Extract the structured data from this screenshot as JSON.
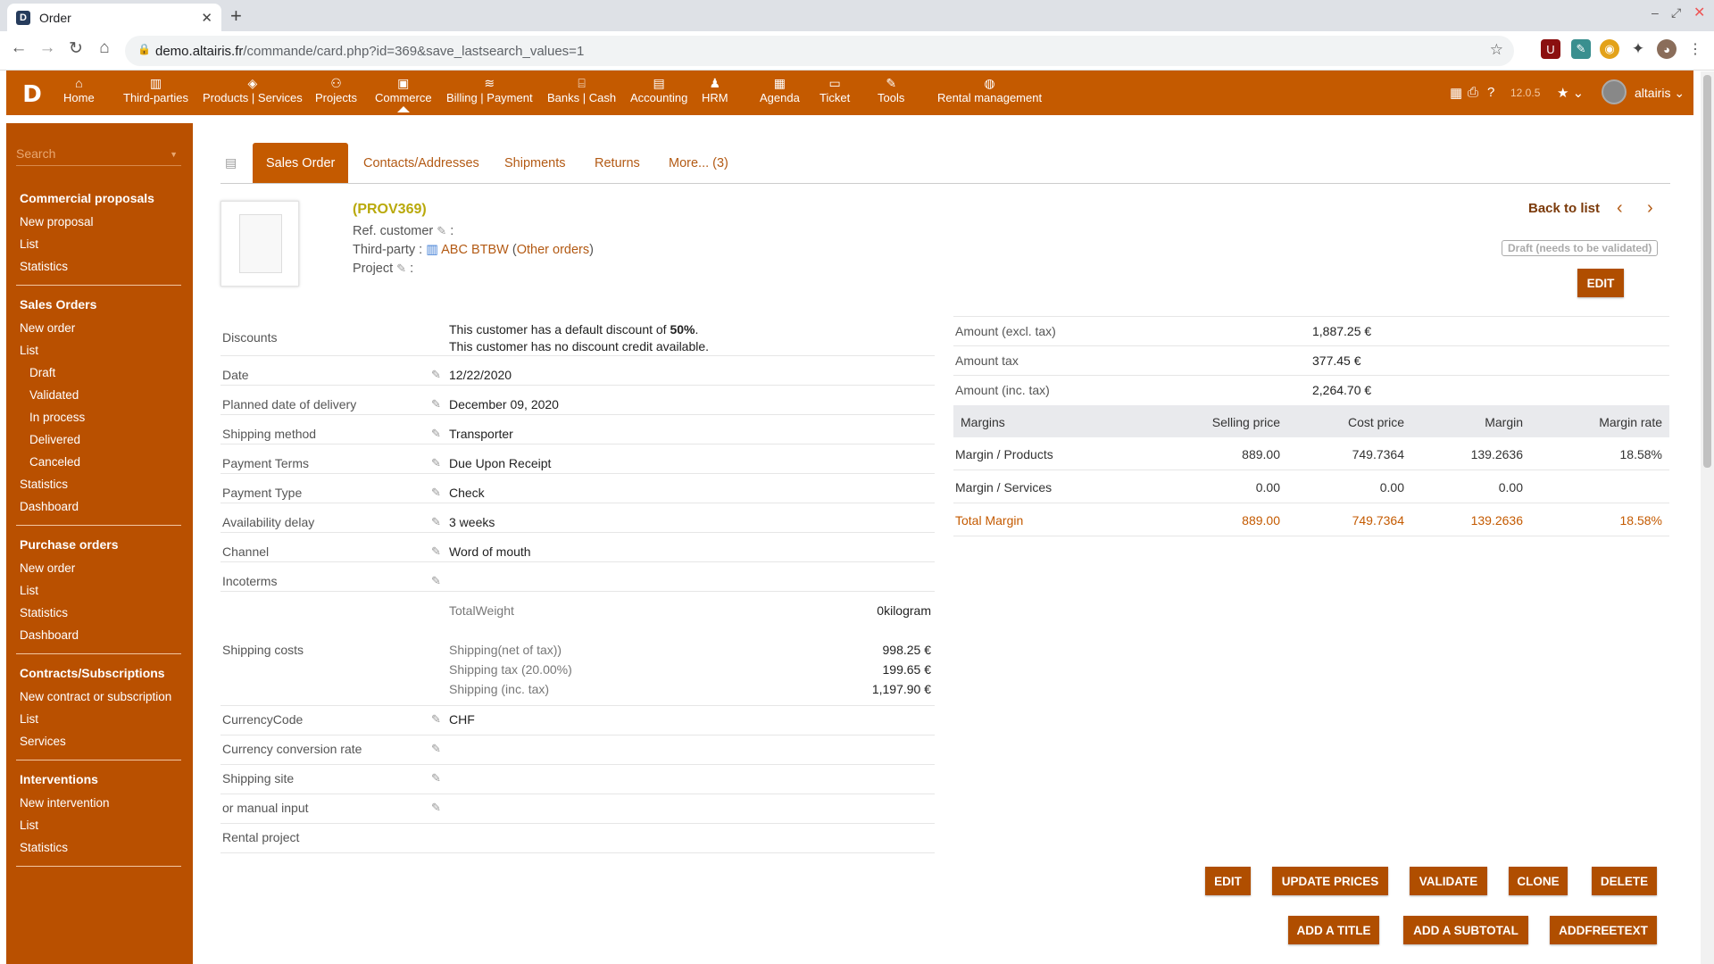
{
  "browser": {
    "tab_title": "Order",
    "favicon_letter": "D",
    "url_domain": "demo.altairis.fr",
    "url_path": "/commande/card.php?id=369&save_lastsearch_values=1"
  },
  "topmenu": {
    "logo_letter": "D",
    "items": [
      {
        "label": "Home",
        "icon": "home-icon"
      },
      {
        "label": "Third-parties",
        "icon": "building-icon"
      },
      {
        "label": "Products | Services",
        "icon": "cube-icon"
      },
      {
        "label": "Projects",
        "icon": "sitemap-icon"
      },
      {
        "label": "Commerce",
        "icon": "briefcase-icon"
      },
      {
        "label": "Billing | Payment",
        "icon": "coins-icon"
      },
      {
        "label": "Banks | Cash",
        "icon": "bank-icon"
      },
      {
        "label": "Accounting",
        "icon": "ledger-icon"
      },
      {
        "label": "HRM",
        "icon": "user-tie-icon"
      },
      {
        "label": "Agenda",
        "icon": "calendar-icon"
      },
      {
        "label": "Ticket",
        "icon": "ticket-icon"
      },
      {
        "label": "Tools",
        "icon": "wrench-icon"
      },
      {
        "label": "Rental management",
        "icon": "rental-icon"
      }
    ],
    "version": "12.0.5",
    "username": "altairis"
  },
  "leftmenu": {
    "search_placeholder": "Search",
    "sections": [
      {
        "title": "Commercial proposals",
        "items": [
          "New proposal",
          "List",
          "Statistics"
        ]
      },
      {
        "title": "Sales Orders",
        "items": [
          "New order",
          "List"
        ],
        "subitems": [
          "Draft",
          "Validated",
          "In process",
          "Delivered",
          "Canceled"
        ],
        "after": [
          "Statistics",
          "Dashboard"
        ]
      },
      {
        "title": "Purchase orders",
        "items": [
          "New order",
          "List",
          "Statistics",
          "Dashboard"
        ]
      },
      {
        "title": "Contracts/Subscriptions",
        "items": [
          "New contract or subscription",
          "List",
          "Services"
        ]
      },
      {
        "title": "Interventions",
        "items": [
          "New intervention",
          "List",
          "Statistics"
        ]
      }
    ]
  },
  "tabs": [
    "Sales Order",
    "Contacts/Addresses",
    "Shipments",
    "Returns",
    "More... (3)"
  ],
  "header": {
    "ref": "(PROV369)",
    "ref_customer_label": "Ref. customer",
    "thirdparty_label": "Third-party :",
    "thirdparty_name": "ABC BTBW",
    "other_orders": "Other orders",
    "project_label": "Project",
    "colon": ":",
    "back_to_list": "Back to list",
    "status": "Draft (needs to be validated)",
    "edit_label": "EDIT"
  },
  "fields": {
    "discounts_label": "Discounts",
    "discount_line1_pre": "This customer has a default discount of ",
    "discount_value": "50%",
    "discount_line1_post": ".",
    "discount_line2": "This customer has no discount credit available.",
    "date_label": "Date",
    "date": "12/22/2020",
    "delivery_label": "Planned date of delivery",
    "delivery": "December 09, 2020",
    "shipping_method_label": "Shipping method",
    "shipping_method": "Transporter",
    "payment_terms_label": "Payment Terms",
    "payment_terms": "Due Upon Receipt",
    "payment_type_label": "Payment Type",
    "payment_type": "Check",
    "availability_label": "Availability delay",
    "availability": "3 weeks",
    "channel_label": "Channel",
    "channel": "Word of mouth",
    "incoterms_label": "Incoterms",
    "total_weight_label": "TotalWeight",
    "total_weight": "0kilogram",
    "shipping_costs_label": "Shipping costs",
    "shipping_net_label": "Shipping(net of tax))",
    "shipping_net": "998.25 €",
    "shipping_tax_label": "Shipping tax (20.00%)",
    "shipping_tax": "199.65 €",
    "shipping_inc_label": "Shipping (inc. tax)",
    "shipping_inc": "1,197.90 €",
    "currency_label": "CurrencyCode",
    "currency": "CHF",
    "conversion_label": "Currency conversion rate",
    "shipping_site_label": "Shipping site",
    "manual_input_label": "or manual input",
    "rental_label": "Rental project"
  },
  "amounts": {
    "excl_label": "Amount (excl. tax)",
    "excl": "1,887.25 €",
    "tax_label": "Amount tax",
    "tax": "377.45 €",
    "inc_label": "Amount (inc. tax)",
    "inc": "2,264.70 €"
  },
  "margins": {
    "headers": [
      "Margins",
      "Selling price",
      "Cost price",
      "Margin",
      "Margin rate"
    ],
    "rows": [
      [
        "Margin / Products",
        "889.00",
        "749.7364",
        "139.2636",
        "18.58%"
      ],
      [
        "Margin / Services",
        "0.00",
        "0.00",
        "0.00",
        ""
      ],
      [
        "Total Margin",
        "889.00",
        "749.7364",
        "139.2636",
        "18.58%"
      ]
    ]
  },
  "actions": {
    "row1": [
      "EDIT",
      "UPDATE PRICES",
      "VALIDATE",
      "CLONE",
      "DELETE"
    ],
    "row2": [
      "ADD A TITLE",
      "ADD A SUBTOTAL",
      "ADDFREETEXT"
    ]
  },
  "colors": {
    "brand": "#c45a00",
    "leftmenu": "#b95000",
    "link": "#b35a14",
    "ref": "#b9a90b"
  }
}
